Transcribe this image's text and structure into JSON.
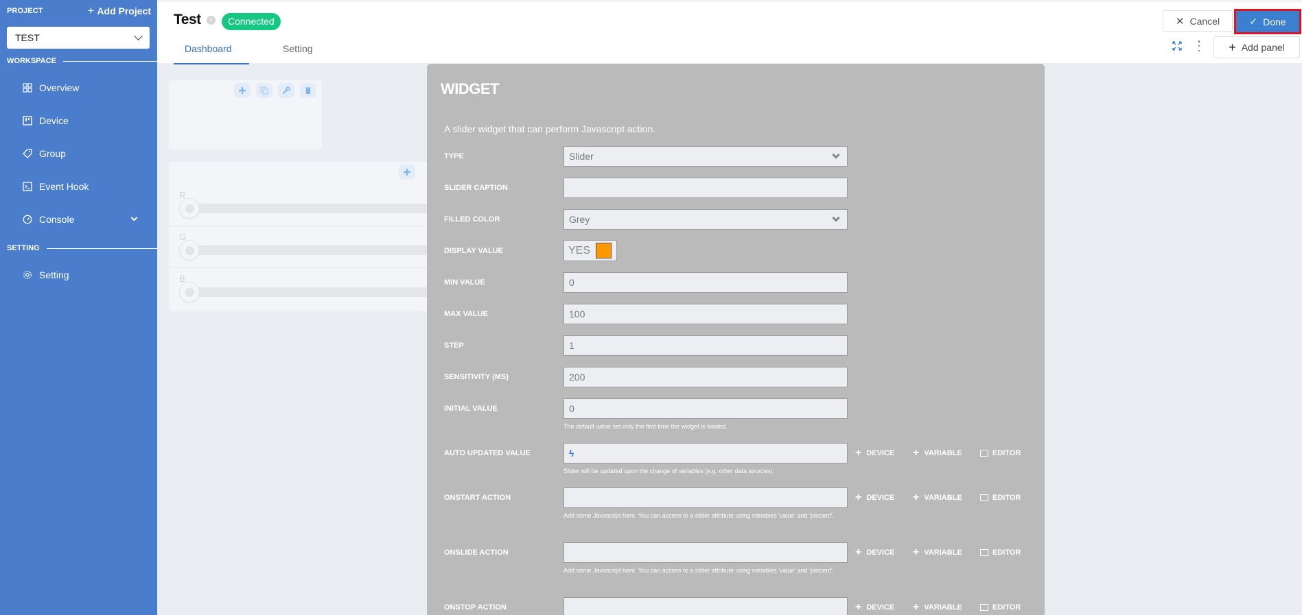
{
  "sidebar": {
    "project_label": "PROJECT",
    "add_project_label": "Add Project",
    "project_select_value": "TEST",
    "workspace_label": "WORKSPACE",
    "setting_section_label": "SETTING",
    "items": [
      {
        "label": "Overview",
        "icon": "grid-icon"
      },
      {
        "label": "Device",
        "icon": "device-board-icon"
      },
      {
        "label": "Group",
        "icon": "tag-icon"
      },
      {
        "label": "Event Hook",
        "icon": "terminal-icon"
      },
      {
        "label": "Console",
        "icon": "gauge-icon"
      },
      {
        "label": "Setting",
        "icon": "gear-icon"
      }
    ],
    "accent_color": "#4a7dcb"
  },
  "header": {
    "title": "Test",
    "status_badge": "Connected",
    "status_color": "#16c784",
    "tabs": [
      {
        "label": "Dashboard",
        "active": true
      },
      {
        "label": "Setting",
        "active": false
      }
    ],
    "cancel_label": "Cancel",
    "done_label": "Done",
    "add_panel_label": "Add panel"
  },
  "dashboard": {
    "sliders": [
      {
        "label": "R",
        "value": 0
      },
      {
        "label": "G",
        "value": 0
      },
      {
        "label": "B",
        "value": 0
      }
    ]
  },
  "modal": {
    "title": "WIDGET",
    "description": "A slider widget that can perform Javascript action.",
    "fields": {
      "type": {
        "label": "TYPE",
        "value": "Slider"
      },
      "slider_caption": {
        "label": "SLIDER CAPTION",
        "value": ""
      },
      "filled_color": {
        "label": "FILLED COLOR",
        "value": "Grey"
      },
      "display_value": {
        "label": "DISPLAY VALUE",
        "value": "YES",
        "swatch_color": "#ff9800"
      },
      "min_value": {
        "label": "MIN VALUE",
        "value": "0"
      },
      "max_value": {
        "label": "MAX VALUE",
        "value": "100"
      },
      "step": {
        "label": "STEP",
        "value": "1"
      },
      "sensitivity": {
        "label": "SENSITIVITY (MS)",
        "value": "200"
      },
      "initial_value": {
        "label": "INITIAL VALUE",
        "value": "0",
        "help": "The default value set only the first time the widget is loaded."
      },
      "auto_updated_value": {
        "label": "AUTO UPDATED VALUE",
        "value": "",
        "help": "Slider will be updated upon the change of variables (e.g. other data sources)."
      },
      "onstart_action": {
        "label": "ONSTART ACTION",
        "value": "",
        "help": "Add some Javascript here. You can access to a slider attribute using variables 'value' and 'percent'."
      },
      "onslide_action": {
        "label": "ONSLIDE ACTION",
        "value": "",
        "help": "Add some Javascript here. You can access to a slider attribute using variables 'value' and 'percent'."
      },
      "onstop_action": {
        "label": "ONSTOP ACTION",
        "value": ""
      }
    },
    "action_labels": {
      "device": "DEVICE",
      "variable": "VARIABLE",
      "editor": "EDITOR"
    }
  }
}
